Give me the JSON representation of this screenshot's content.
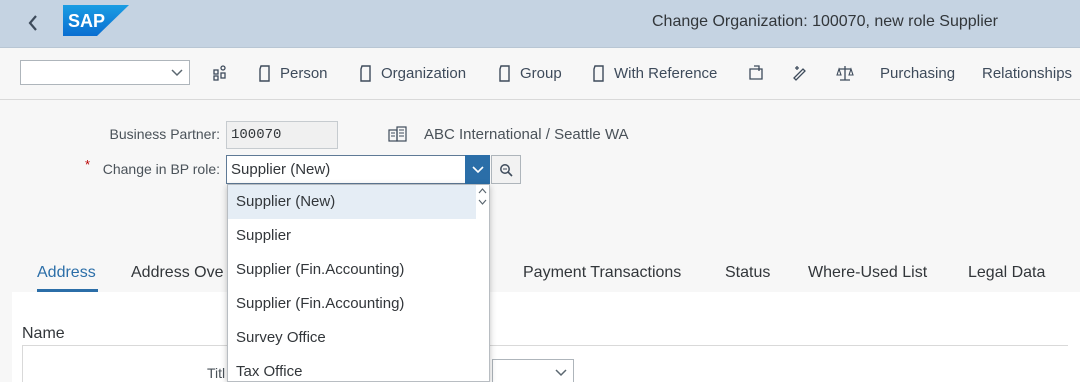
{
  "shell": {
    "title": "Change Organization: 100070, new role Supplier",
    "logo_text": "SAP"
  },
  "toolbar": {
    "select_value": "",
    "items": [
      {
        "label": "Person",
        "icon": "document-icon"
      },
      {
        "label": "Organization",
        "icon": "document-icon"
      },
      {
        "label": "Group",
        "icon": "document-icon"
      },
      {
        "label": "With Reference",
        "icon": "document-icon"
      },
      {
        "label": "Purchasing"
      },
      {
        "label": "Relationships"
      }
    ]
  },
  "header": {
    "bp_label": "Business Partner:",
    "bp_value": "100070",
    "bp_name": "ABC International / Seattle WA",
    "role_label": "Change in BP role:",
    "role_required_mark": "*",
    "role_value": "Supplier (New)"
  },
  "tabs": [
    "Address",
    "Address Ove",
    "Payment Transactions",
    "Status",
    "Where-Used List",
    "Legal Data"
  ],
  "content": {
    "section_title": "Name",
    "title_label": "Titl"
  },
  "dropdown": {
    "options": [
      "Supplier (New)",
      "Supplier",
      "Supplier (Fin.Accounting)",
      "Supplier (Fin.Accounting)",
      "Survey Office",
      "Tax Office"
    ],
    "selected_index": 0
  },
  "colors": {
    "shell_bg": "#c5d3e2",
    "accent": "#2b6ea8",
    "required": "#bb0000"
  }
}
